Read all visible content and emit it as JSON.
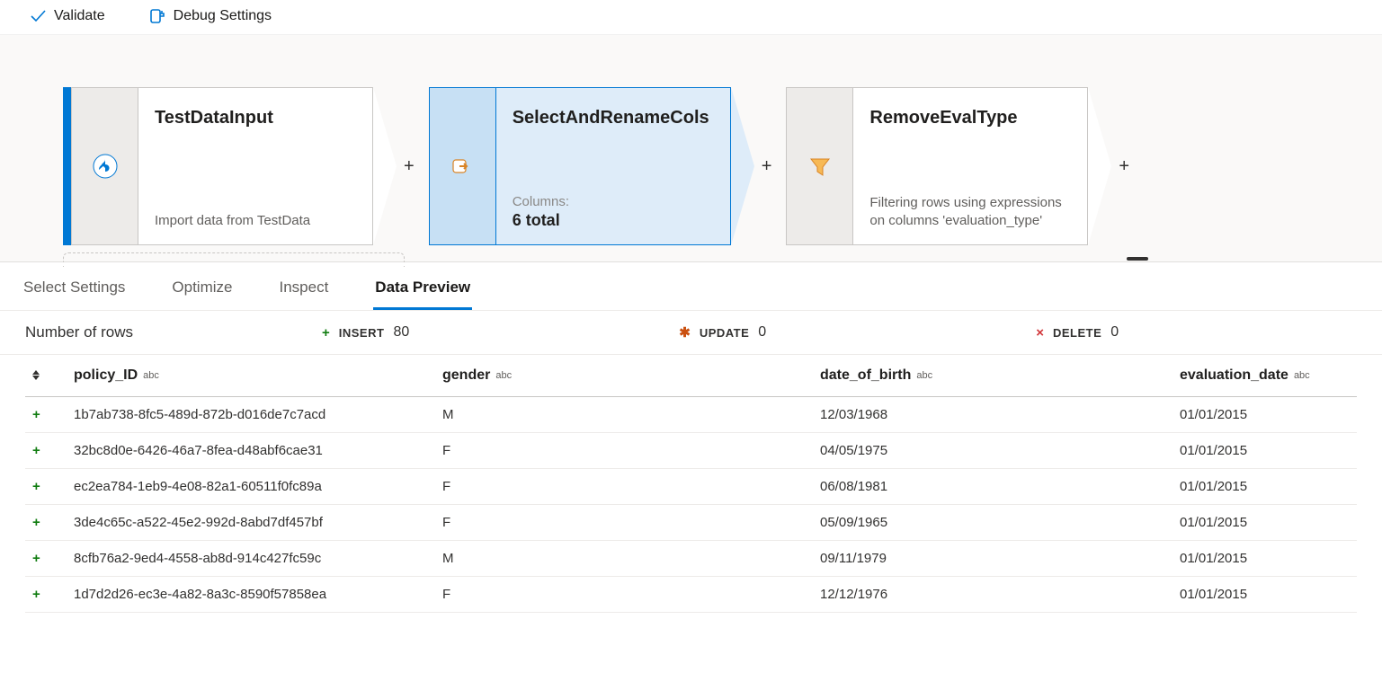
{
  "toolbar": {
    "validate": "Validate",
    "debug_settings": "Debug Settings"
  },
  "nodes": {
    "source": {
      "title": "TestDataInput",
      "desc": "Import data from TestData"
    },
    "select": {
      "title": "SelectAndRenameCols",
      "sub_label": "Columns:",
      "sub_value": "6 total"
    },
    "filter": {
      "title": "RemoveEvalType",
      "desc": "Filtering rows using expressions on columns 'evaluation_type'"
    },
    "plus": "+"
  },
  "tabs": {
    "select_settings": "Select Settings",
    "optimize": "Optimize",
    "inspect": "Inspect",
    "data_preview": "Data Preview"
  },
  "stats": {
    "rows_label": "Number of rows",
    "insert": {
      "name": "INSERT",
      "value": "80"
    },
    "update": {
      "name": "UPDATE",
      "value": "0"
    },
    "delete": {
      "name": "DELETE",
      "value": "0"
    }
  },
  "columns": {
    "policy_id": {
      "name": "policy_ID",
      "type": "abc"
    },
    "gender": {
      "name": "gender",
      "type": "abc"
    },
    "dob": {
      "name": "date_of_birth",
      "type": "abc"
    },
    "eval_date": {
      "name": "evaluation_date",
      "type": "abc"
    }
  },
  "rows": [
    {
      "policy_id": "1b7ab738-8fc5-489d-872b-d016de7c7acd",
      "gender": "M",
      "dob": "12/03/1968",
      "eval_date": "01/01/2015"
    },
    {
      "policy_id": "32bc8d0e-6426-46a7-8fea-d48abf6cae31",
      "gender": "F",
      "dob": "04/05/1975",
      "eval_date": "01/01/2015"
    },
    {
      "policy_id": "ec2ea784-1eb9-4e08-82a1-60511f0fc89a",
      "gender": "F",
      "dob": "06/08/1981",
      "eval_date": "01/01/2015"
    },
    {
      "policy_id": "3de4c65c-a522-45e2-992d-8abd7df457bf",
      "gender": "F",
      "dob": "05/09/1965",
      "eval_date": "01/01/2015"
    },
    {
      "policy_id": "8cfb76a2-9ed4-4558-ab8d-914c427fc59c",
      "gender": "M",
      "dob": "09/11/1979",
      "eval_date": "01/01/2015"
    },
    {
      "policy_id": "1d7d2d26-ec3e-4a82-8a3c-8590f57858ea",
      "gender": "F",
      "dob": "12/12/1976",
      "eval_date": "01/01/2015"
    }
  ]
}
